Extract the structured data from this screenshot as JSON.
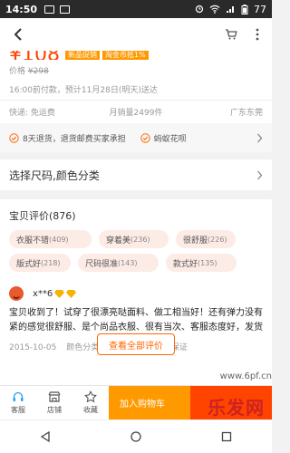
{
  "status_bar": {
    "time": "14:50",
    "battery": "77"
  },
  "price": {
    "current": "¥108",
    "tags": [
      "新品促销",
      "淘金币抵1%"
    ],
    "original_label": "价格",
    "original_value": "¥298",
    "ship_time": "16:00前付款，预计11月28日(明天)送达"
  },
  "info": {
    "shipping": "快递: 免运费",
    "monthly_sales": "月销量2499件",
    "location": "广东东莞"
  },
  "services": {
    "return": "8天退货，退货邮费买家承担",
    "huabei": "蚂蚁花呗"
  },
  "size_select": {
    "label": "选择尺码,颜色分类"
  },
  "reviews": {
    "title": "宝贝评价(876)",
    "tags": [
      {
        "label": "衣服不错",
        "count": "(409)"
      },
      {
        "label": "穿着美",
        "count": "(236)"
      },
      {
        "label": "很舒服",
        "count": "(226)"
      },
      {
        "label": "版式好",
        "count": "(218)"
      },
      {
        "label": "尺码很准",
        "count": "(143)"
      },
      {
        "label": "款式好",
        "count": "(135)"
      }
    ],
    "reviewer_name": "x**6",
    "text": "宝贝收到了！试穿了很漂亮哒面料、做工相当好！还有弹力没有紧的感觉很舒服、是个尚品衣服、很有当次、客服态度好，发货快、全..",
    "date": "2015-10-05",
    "sku": "颜色分类:黑色;尺码:S",
    "guarantee": "质量保证",
    "view_all": "查看全部评价"
  },
  "bottom_bar": {
    "service": "客服",
    "shop": "店铺",
    "favorite": "收藏",
    "add_cart": "加入购物车"
  },
  "watermark": {
    "url": "www.6pf.cn",
    "name": "乐发网"
  },
  "colors": {
    "accent": "#ff4400",
    "tag_bg": "#fdebe6",
    "add_cart": "#ff9900"
  }
}
